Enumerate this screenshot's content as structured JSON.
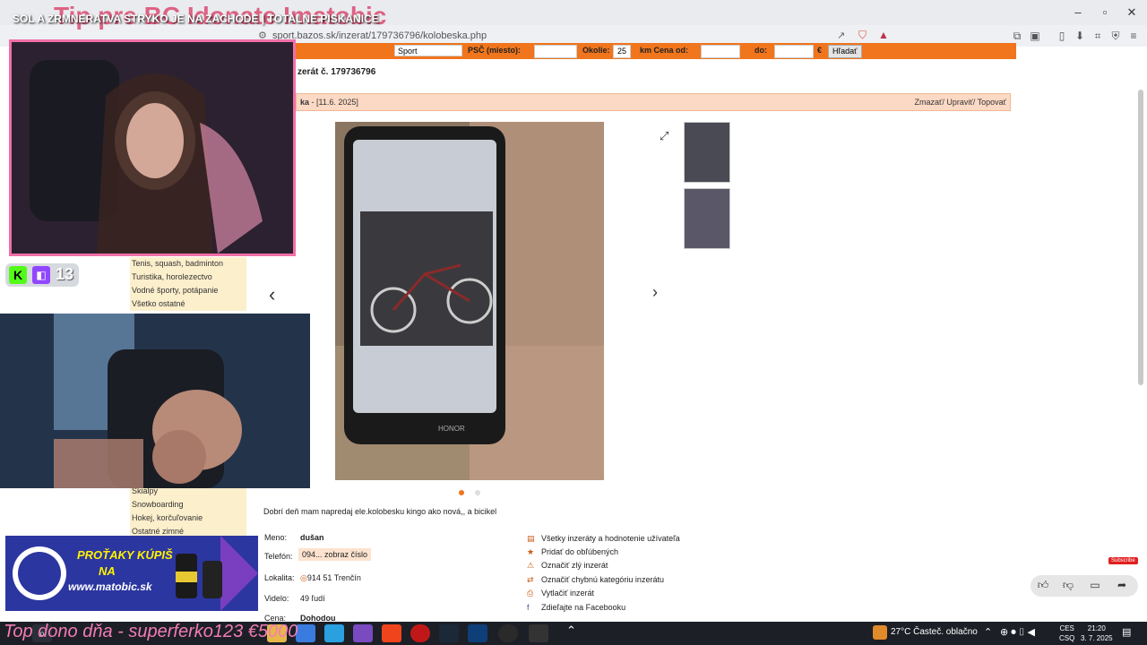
{
  "stream": {
    "title": "SOL A ZRMNERATVA STRYKO JE NA ZACHODE | TOTALNE PISKANICE",
    "overlay_title": "Tip pre BC Idonate Imatobic",
    "viewer_count": "13",
    "marquee": "Top dono dňa - superferko123 €5000"
  },
  "browser": {
    "url": "sport.bazos.sk/inzerat/179736796/kolobeska.php"
  },
  "search_bar": {
    "category": "Sport",
    "psc_label": "PSČ (miesto):",
    "okolie_label": "Okolie:",
    "okolie_value": "25",
    "km_cena_label": "km  Cena  od:",
    "do_label": "do:",
    "currency": "€",
    "search_button": "Hľadať"
  },
  "ad": {
    "number_label": "zerát č. 179736796",
    "title": "ka",
    "date": "- [11.6. 2025]",
    "actions": "Zmazať/ Upraviť/ Topovať",
    "description": "Dobrí deň mam napredaj ele.kolobesku kingo ako nová,, a bicikel",
    "meno_label": "Meno:",
    "meno": "dušan",
    "telefon_label": "Telefón:",
    "telefon": "094... zobraz číslo",
    "lokalita_label": "Lokalita:",
    "lokalita": "914 51 Trenčín",
    "videlo_label": "Videlo:",
    "videlo": "49 ľudí",
    "cena_label": "Cena:",
    "cena": "Dohodou",
    "side_actions": [
      "Všetky inzeráty a hodnotenie užívateľa",
      "Pridať do obľúbených",
      "Označiť zlý inzerát",
      "Označiť chybnú kategóriu inzerátu",
      "Vytlačiť inzerát",
      "Zdieľajte na Facebooku"
    ]
  },
  "categories_top": [
    "Tenis, squash, badminton",
    "Turistika, horolezectvo",
    "Vodné športy, potápanie",
    "Všetko ostatné"
  ],
  "categories_bottom": [
    "Skialpy",
    "Snowboarding",
    "Hokej, korčuľovanie",
    "Ostatné zimné"
  ],
  "promo": {
    "line1": "PROŤAKY KÚPIŠ",
    "line2": "NA",
    "line3": "www.matobic.sk"
  },
  "taskbar": {
    "weather": "27°C  Časteč. oblačno",
    "lang1": "CES",
    "lang2": "CSQ",
    "time": "21:20",
    "date": "3. 7. 2025"
  },
  "subscribe": "Subscribe"
}
